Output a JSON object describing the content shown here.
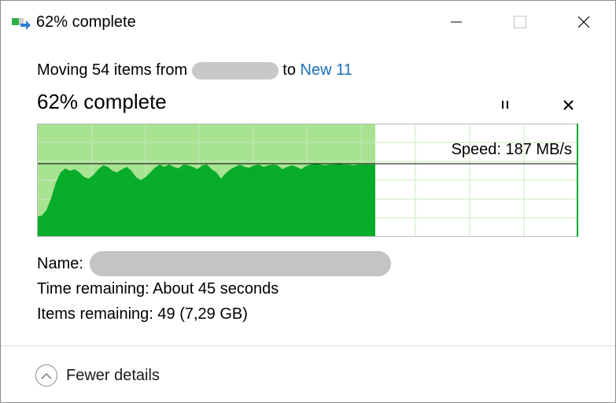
{
  "window": {
    "title": "62% complete",
    "icon": "file-move-icon"
  },
  "transfer": {
    "moving_prefix": "Moving 54 items from",
    "moving_to": "to",
    "destination": "New 11",
    "progress_title": "62% complete",
    "progress_percent": 62,
    "speed_text": "Speed: 187 MB/s"
  },
  "details": {
    "name_label": "Name:",
    "time_label": "Time remaining:",
    "time_value": "About 45 seconds",
    "items_label": "Items remaining:",
    "items_value": "49 (7,29 GB)"
  },
  "footer": {
    "toggle_label": "Fewer details"
  },
  "colors": {
    "graph_fill": "#06ac2a",
    "graph_done_bg": "#a8e392",
    "graph_grid": "#c9e9c0",
    "link": "#1a6fb8"
  }
}
